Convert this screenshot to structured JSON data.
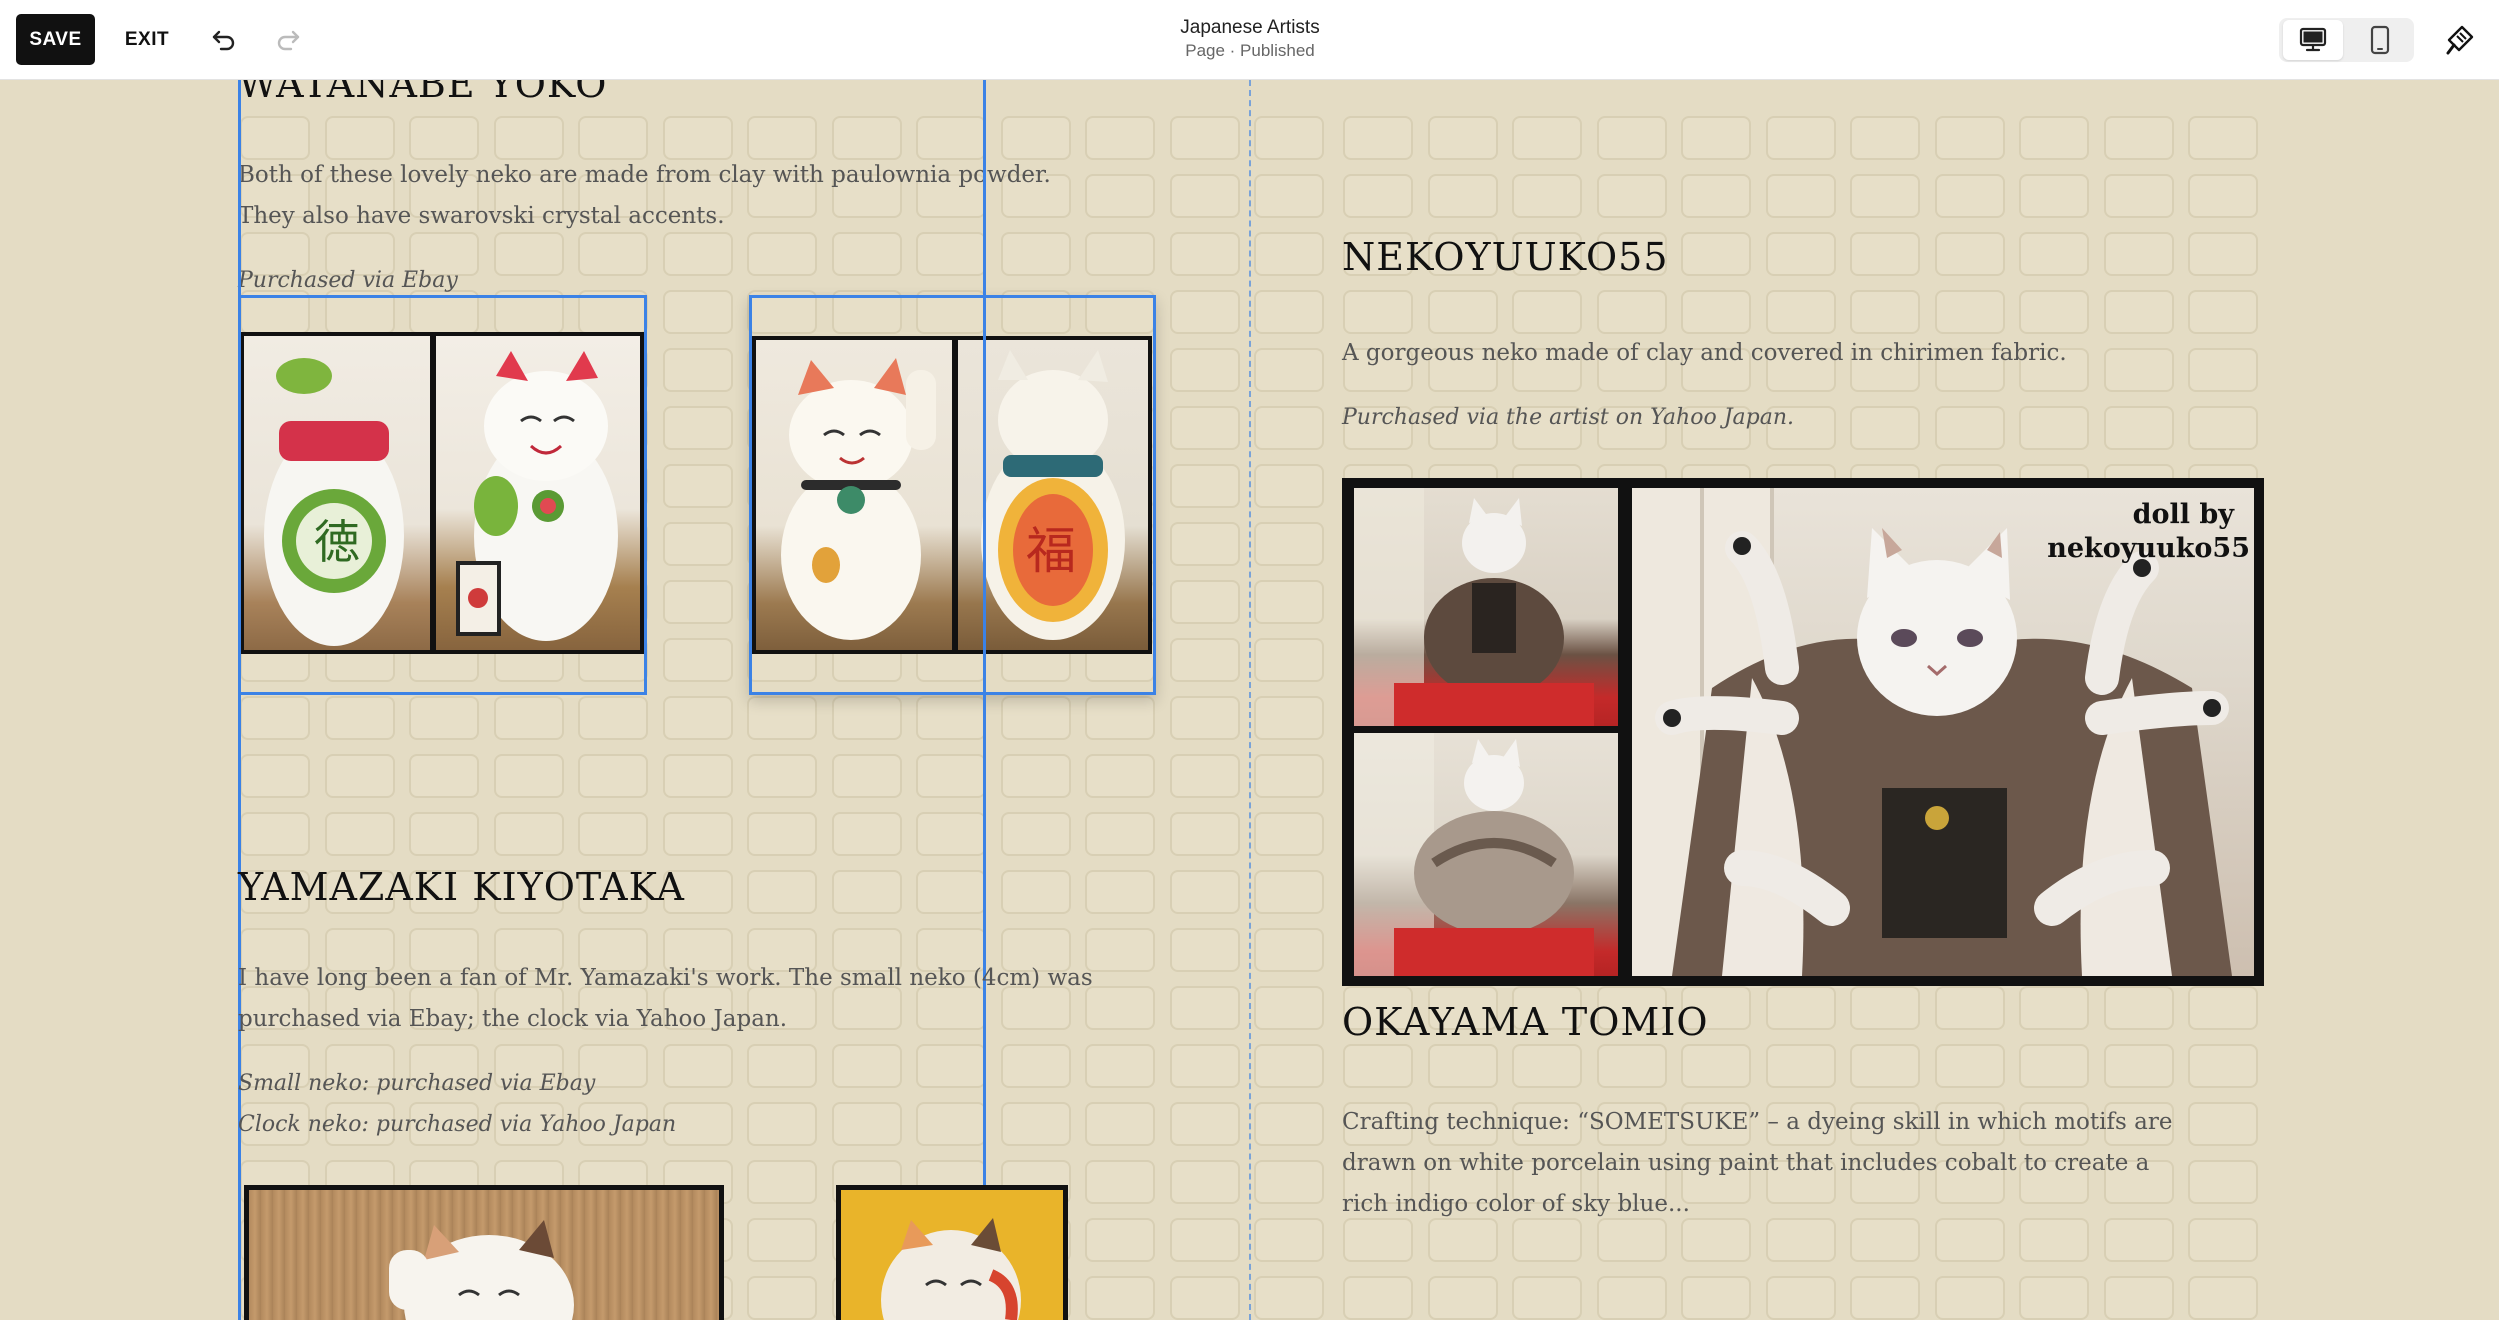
{
  "toolbar": {
    "save_label": "SAVE",
    "exit_label": "EXIT",
    "title": "Japanese Artists",
    "subtitle": "Page · Published",
    "icons": [
      "undo-icon",
      "redo-icon",
      "desktop-view-icon",
      "mobile-view-icon",
      "site-styles-icon"
    ]
  },
  "sections": {
    "watanabe": {
      "heading": "WATANABE YOKO",
      "para_line1": "Both of these lovely neko are made from clay with paulownia powder.",
      "para_line2": "They also have swarovski crystal accents.",
      "note": "Purchased via Ebay"
    },
    "yamazaki": {
      "heading": "YAMAZAKI KIYOTAKA",
      "para_line1": "I have long been a fan of Mr. Yamazaki's work. The small neko (4cm) was",
      "para_line2": "purchased via Ebay; the clock via Yahoo Japan.",
      "note1": "Small neko: purchased via Ebay",
      "note2": "Clock neko: purchased via Yahoo Japan"
    },
    "nekoyuuko": {
      "heading": "NEKOYUUKO55",
      "para": "A gorgeous neko made of clay and covered in chirimen fabric.",
      "note": "Purchased via the artist on Yahoo Japan.",
      "watermark_line1": "doll by",
      "watermark_line2": "nekoyuuko55"
    },
    "okayama": {
      "heading": "OKAYAMA TOMIO",
      "para_line1": "Crafting technique: “SOMETSUKE” – a dyeing skill in which motifs are",
      "para_line2": "drawn on white porcelain using paint that includes cobalt to create a",
      "para_line3": "rich indigo color of sky blue..."
    }
  },
  "colors": {
    "background": "#e4dcc4",
    "selection": "#3b82e6",
    "heading": "#111111",
    "body_text": "#555555"
  }
}
